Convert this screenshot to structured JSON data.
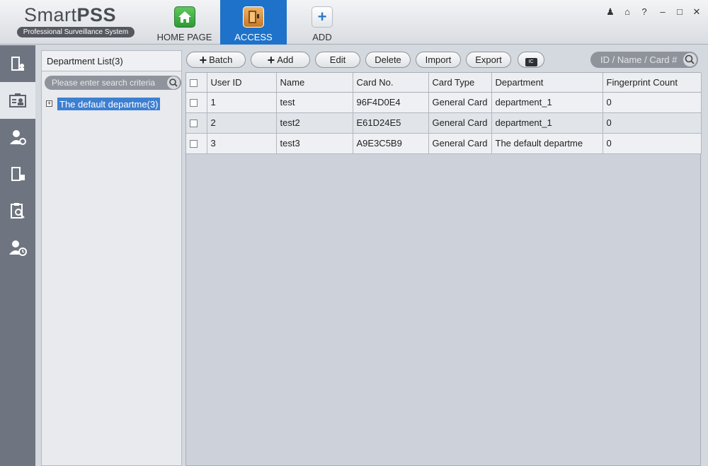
{
  "app": {
    "logo_brand_light": "Smart",
    "logo_brand_bold": "PSS",
    "logo_subtitle": "Professional Surveillance System"
  },
  "nav": {
    "tabs": [
      {
        "label": "HOME PAGE",
        "icon": "home-icon"
      },
      {
        "label": "ACCESS",
        "icon": "door-icon",
        "active": true
      },
      {
        "label": "ADD",
        "icon": "plus-icon",
        "glyph": "+"
      }
    ]
  },
  "window_controls": {
    "user": "♟",
    "lock": "⌂",
    "help": "?",
    "minimize": "–",
    "maximize": "□",
    "close": "✕"
  },
  "rail": {
    "items": [
      {
        "icon": "door-user-icon"
      },
      {
        "icon": "person-card-icon",
        "active": true
      },
      {
        "icon": "user-settings-icon"
      },
      {
        "icon": "door-lock-icon"
      },
      {
        "icon": "clipboard-search-icon"
      },
      {
        "icon": "user-clock-icon"
      }
    ]
  },
  "department_panel": {
    "title": "Department List(3)",
    "search_placeholder": "Please enter search criteria",
    "tree_expander": "+",
    "tree_node_label": "The default departme(3)"
  },
  "toolbar": {
    "batch_label": "Batch",
    "add_label": "Add",
    "edit_label": "Edit",
    "delete_label": "Delete",
    "import_label": "Import",
    "export_label": "Export",
    "ic_label": "IC",
    "search_placeholder": "ID / Name / Card #"
  },
  "table": {
    "headers": {
      "user_id": "User ID",
      "name": "Name",
      "card_no": "Card No.",
      "card_type": "Card Type",
      "department": "Department",
      "fingerprint_count": "Fingerprint Count"
    },
    "rows": [
      {
        "user_id": "1",
        "name": "test",
        "card_no": "96F4D0E4",
        "card_type": "General Card",
        "department": "department_1",
        "fingerprint_count": "0"
      },
      {
        "user_id": "2",
        "name": "test2",
        "card_no": "E61D24E5",
        "card_type": "General Card",
        "department": "department_1",
        "fingerprint_count": "0"
      },
      {
        "user_id": "3",
        "name": "test3",
        "card_no": "A9E3C5B9",
        "card_type": "General Card",
        "department": "The default departme",
        "fingerprint_count": "0"
      }
    ]
  },
  "colors": {
    "accent": "#1e72c9",
    "selection": "#3d7fd1",
    "rail": "#6f7580"
  }
}
